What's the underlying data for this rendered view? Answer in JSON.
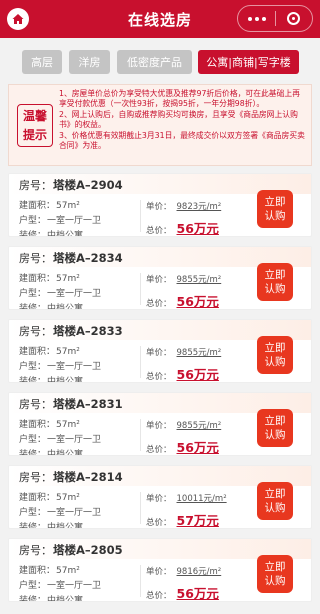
{
  "header": {
    "title": "在线选房",
    "home_icon": "home-icon",
    "more_icon": "more-dots-icon",
    "close_icon": "target-icon"
  },
  "filters": [
    {
      "label": "高层",
      "active": false
    },
    {
      "label": "洋房",
      "active": false
    },
    {
      "label": "低密度产品",
      "active": false
    },
    {
      "label": "公寓|商铺|写字楼",
      "active": true
    }
  ],
  "notice": {
    "badge_line1": "温馨",
    "badge_line2": "提示",
    "lines": [
      "1、房屋单价总价为享受特大优惠及推荐97折后价格，可在此基础上再享受付款优惠（一次性93折，按揭95折，一年分期98折）。",
      "2、网上认购后，自购或推荐购买均可换房，且享受《商品房网上认购书》的权益。",
      "3、价格优惠有效期截止3月31日，最终成交价以双方签署《商品房买卖合同》为准。"
    ]
  },
  "labels": {
    "room": "房号：",
    "area": "建面积：",
    "layout": "户型：",
    "decor": "装修：",
    "unit_price": "单价：",
    "total_price": "总价：",
    "buy_line1": "立即",
    "buy_line2": "认购"
  },
  "units": [
    {
      "room": "塔楼A–2904",
      "area": "57m²",
      "layout": "一室一厅一卫",
      "decor": "中档公寓",
      "unit_price": "9823元/m²",
      "total": "56万元"
    },
    {
      "room": "塔楼A–2834",
      "area": "57m²",
      "layout": "一室一厅一卫",
      "decor": "中档公寓",
      "unit_price": "9855元/m²",
      "total": "56万元"
    },
    {
      "room": "塔楼A–2833",
      "area": "57m²",
      "layout": "一室一厅一卫",
      "decor": "中档公寓",
      "unit_price": "9855元/m²",
      "total": "56万元"
    },
    {
      "room": "塔楼A–2831",
      "area": "57m²",
      "layout": "一室一厅一卫",
      "decor": "中档公寓",
      "unit_price": "9855元/m²",
      "total": "56万元"
    },
    {
      "room": "塔楼A–2814",
      "area": "57m²",
      "layout": "一室一厅一卫",
      "decor": "中档公寓",
      "unit_price": "10011元/m²",
      "total": "57万元"
    },
    {
      "room": "塔楼A–2805",
      "area": "57m²",
      "layout": "一室一厅一卫",
      "decor": "中档公寓",
      "unit_price": "9816元/m²",
      "total": "56万元"
    }
  ]
}
